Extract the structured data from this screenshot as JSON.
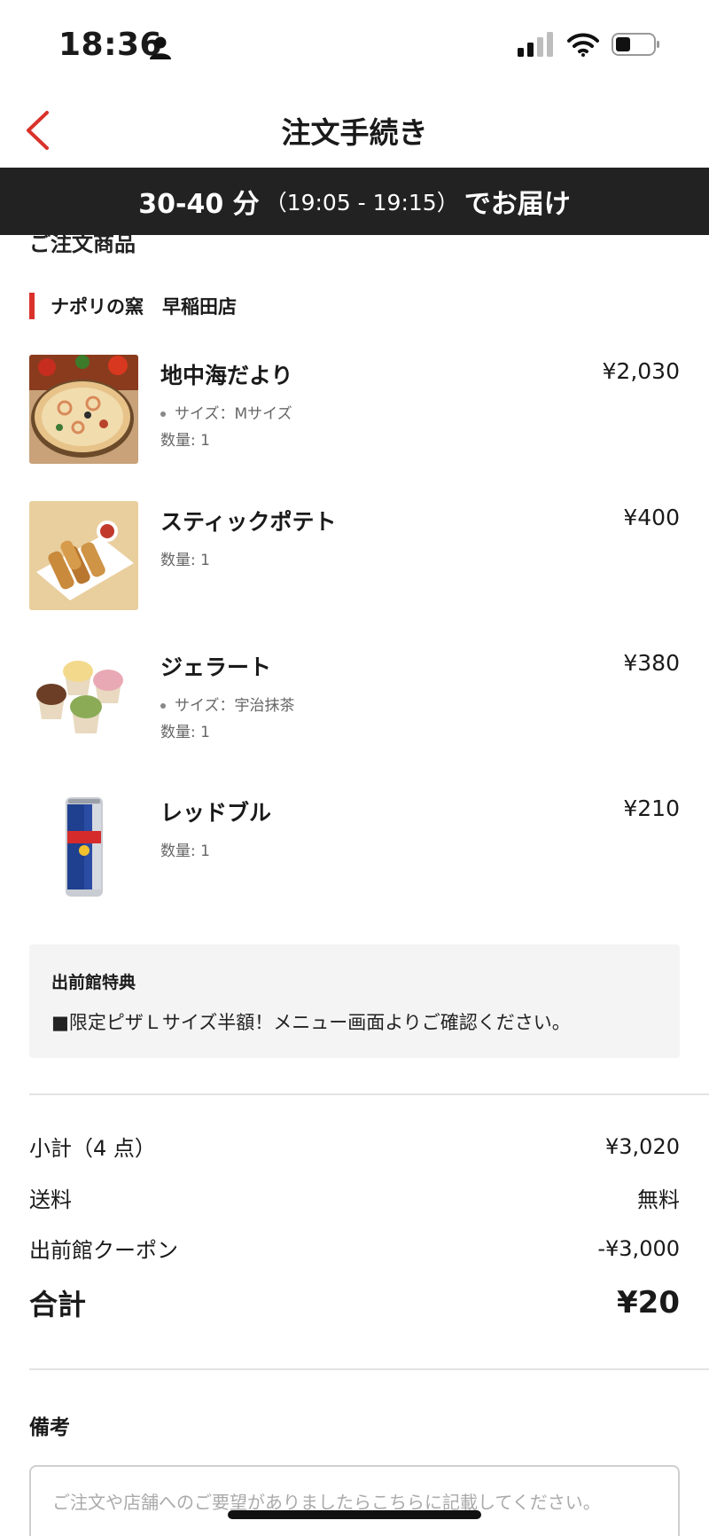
{
  "status_bar": {
    "time": "18:36"
  },
  "nav": {
    "title": "注文手続き"
  },
  "delivery": {
    "range": "30-40 分",
    "window": "（19:05 - 19:15）",
    "suffix": "でお届け"
  },
  "order": {
    "section_title": "ご注文商品",
    "shop_name": "ナポリの窯　早稲田店",
    "items": [
      {
        "name": "地中海だより",
        "price": "¥2,030",
        "option": "サイズ：Mサイズ",
        "qty": "数量: 1",
        "thumb": "pizza"
      },
      {
        "name": "スティックポテト",
        "price": "¥400",
        "qty": "数量: 1",
        "thumb": "potato"
      },
      {
        "name": "ジェラート",
        "price": "¥380",
        "option": "サイズ：宇治抹茶",
        "qty": "数量: 1",
        "thumb": "gelato"
      },
      {
        "name": "レッドブル",
        "price": "¥210",
        "qty": "数量: 1",
        "thumb": "redbull-can"
      }
    ]
  },
  "perk": {
    "title": "出前館特典",
    "text": "■限定ピザＬサイズ半額！メニュー画面よりご確認ください。"
  },
  "summary": {
    "subtotal_label": "小計（4 点）",
    "subtotal_value": "¥3,020",
    "shipping_label": "送料",
    "shipping_value": "無料",
    "coupon_label": "出前館クーポン",
    "coupon_value": "-¥3,000",
    "total_label": "合計",
    "total_value": "¥20"
  },
  "memo": {
    "title": "備考",
    "placeholder": "ご注文や店舗へのご要望がありましたらこちらに記載してください。"
  },
  "colors": {
    "accent_red": "#d9322b",
    "banner_bg": "#222222"
  }
}
